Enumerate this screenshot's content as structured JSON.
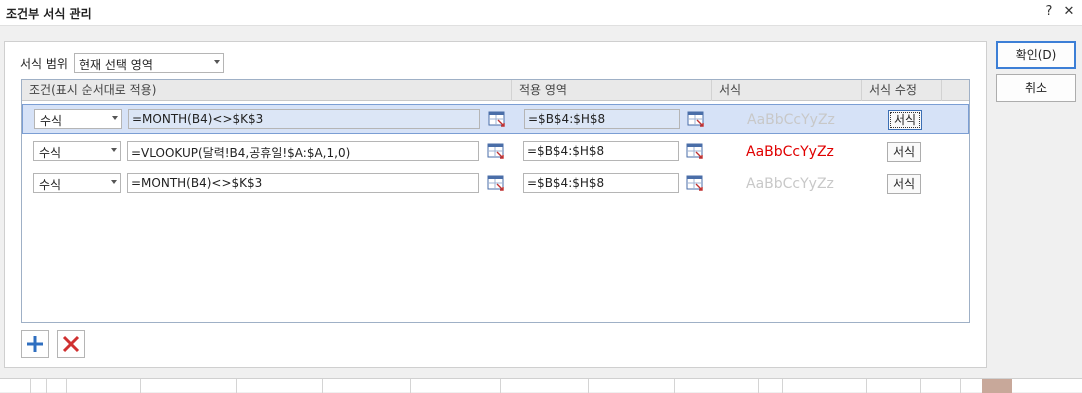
{
  "window": {
    "title": "조건부 서식 관리",
    "help": "?",
    "close": "✕"
  },
  "scope": {
    "label": "서식 범위",
    "value": "현재 선택 영역"
  },
  "grid": {
    "headers": [
      "조건(표시 순서대로 적용)",
      "적용 영역",
      "서식",
      "서식 수정"
    ],
    "rows": [
      {
        "type": "수식",
        "formula": "=MONTH(B4)<>$K$3",
        "range": "=$B$4:$H$8",
        "preview": "AaBbCcYyZz",
        "preview_color": "#c8c8c8",
        "format_button": "서식",
        "selected": true
      },
      {
        "type": "수식",
        "formula": "=VLOOKUP(달력!B4,공휴일!$A:$A,1,0)",
        "range": "=$B$4:$H$8",
        "preview": "AaBbCcYyZz",
        "preview_color": "#e00000",
        "format_button": "서식",
        "selected": false
      },
      {
        "type": "수식",
        "formula": "=MONTH(B4)<>$K$3",
        "range": "=$B$4:$H$8",
        "preview": "AaBbCcYyZz",
        "preview_color": "#c8c8c8",
        "format_button": "서식",
        "selected": false
      }
    ]
  },
  "buttons": {
    "ok": "확인(D)",
    "cancel": "취소"
  },
  "icons": {
    "add": "plus-icon",
    "delete": "x-icon",
    "range_picker": "range-picker-icon"
  },
  "colors": {
    "accent": "#3d7fd6",
    "add_icon": "#2f6fc0",
    "delete_icon": "#d03030",
    "selection": "#d6e2f7"
  }
}
